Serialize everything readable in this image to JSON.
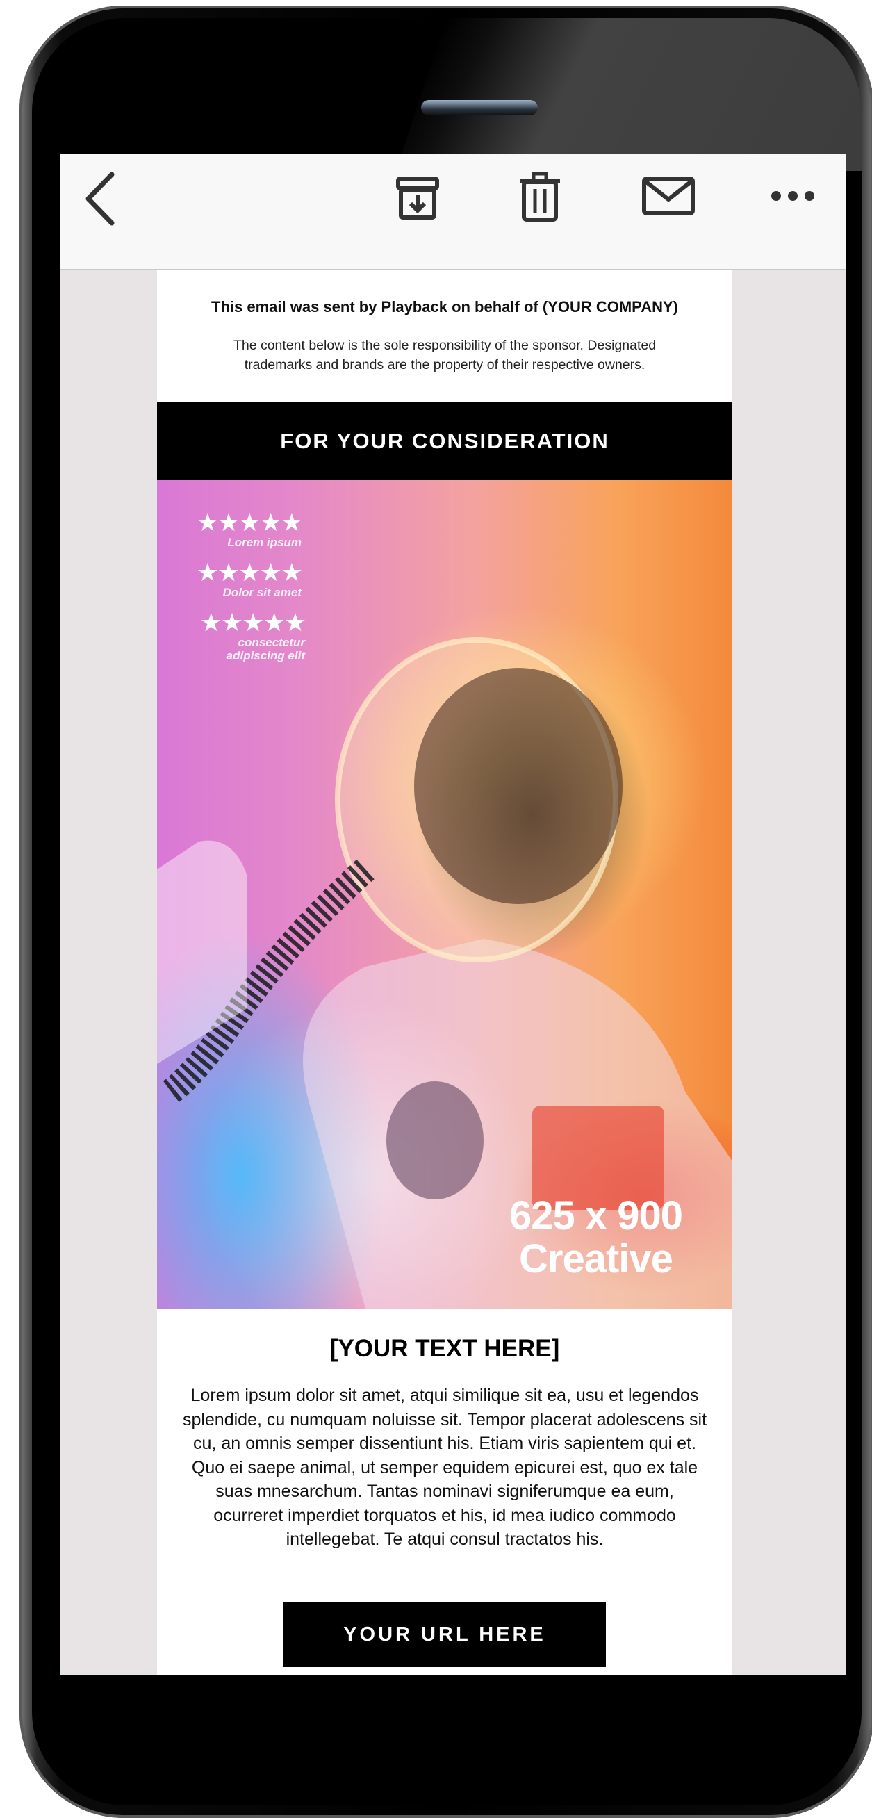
{
  "toolbar": {
    "back_icon": "chevron-left-icon",
    "archive_icon": "archive-download-icon",
    "trash_icon": "trash-icon",
    "mail_icon": "mail-envelope-icon",
    "more_icon": "more-dots-icon"
  },
  "email": {
    "sender_line": "This email was sent by Playback on behalf of (YOUR COMPANY)",
    "disclaimer": "The content below is the sole responsibility of the sponsor. Designated trademarks and brands are the property of their respective owners.",
    "banner": "FOR YOUR CONSIDERATION",
    "hero": {
      "ratings": [
        {
          "stars": "★★★★★",
          "label": "Lorem ipsum"
        },
        {
          "stars": "★★★★★",
          "label": "Dolor sit amet"
        },
        {
          "stars": "★★★★★",
          "label": "consectetur adipiscing elit"
        }
      ],
      "size_line1": "625 x 900",
      "size_line2": "Creative"
    },
    "headline": "[YOUR TEXT HERE]",
    "body": "Lorem ipsum dolor sit amet, atqui similique sit ea, usu et legendos splendide, cu numquam noluisse sit. Tempor placerat adolescens sit cu, an omnis semper dissentiunt his. Etiam viris sapientem qui et. Quo ei saepe animal, ut semper equidem epicurei est, quo ex tale suas mnesarchum. Tantas nominavi signiferumque ea eum, ocurreret imperdiet torquatos et his, id mea iudico commodo intellegebat. Te atqui consul tractatos his.",
    "cta": "YOUR URL HERE"
  },
  "colors": {
    "banner_bg": "#000000",
    "cta_bg": "#000000",
    "screen_bg": "#e8e3e4"
  }
}
